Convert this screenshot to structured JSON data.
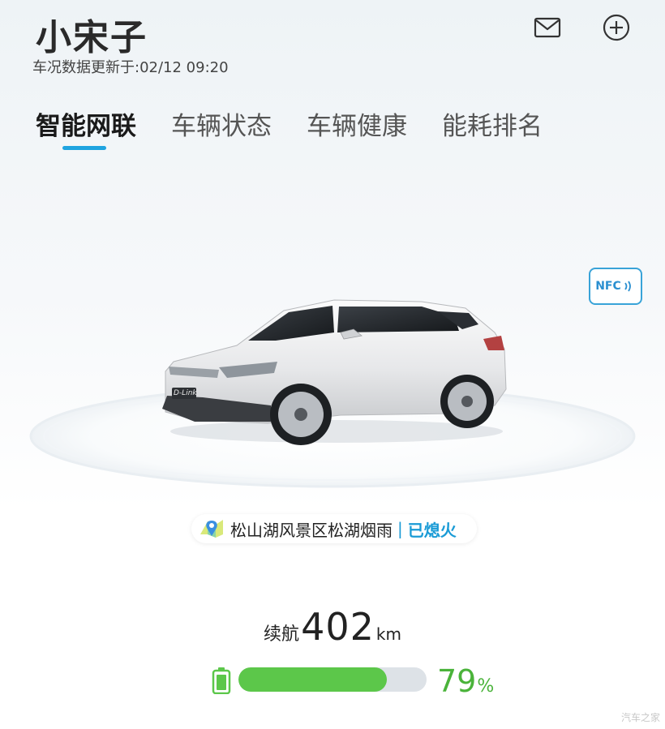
{
  "header": {
    "title": "小宋子",
    "update_label": "车况数据更新于:02/12 09:20"
  },
  "icons": {
    "mail": "mail-icon",
    "add": "add-circle-icon",
    "battery": "battery-icon",
    "location": "map-pin-icon",
    "nfc": "nfc-icon"
  },
  "tabs": [
    {
      "label": "智能网联",
      "active": true
    },
    {
      "label": "车辆状态",
      "active": false
    },
    {
      "label": "车辆健康",
      "active": false
    },
    {
      "label": "能耗排名",
      "active": false
    }
  ],
  "nfc": {
    "label": "NFC"
  },
  "vehicle": {
    "plate_badge": "D-Link",
    "location": "松山湖风景区松湖烟雨",
    "separator": "|",
    "status": "已熄火"
  },
  "range": {
    "label": "续航",
    "value": "402",
    "unit": "km"
  },
  "battery": {
    "percent_value": "79",
    "percent_unit": "%",
    "level": 0.79
  },
  "watermark": "汽车之家",
  "colors": {
    "accent": "#1fa4e0",
    "battery_green": "#5cc74a",
    "percent_green": "#4ab33a"
  }
}
